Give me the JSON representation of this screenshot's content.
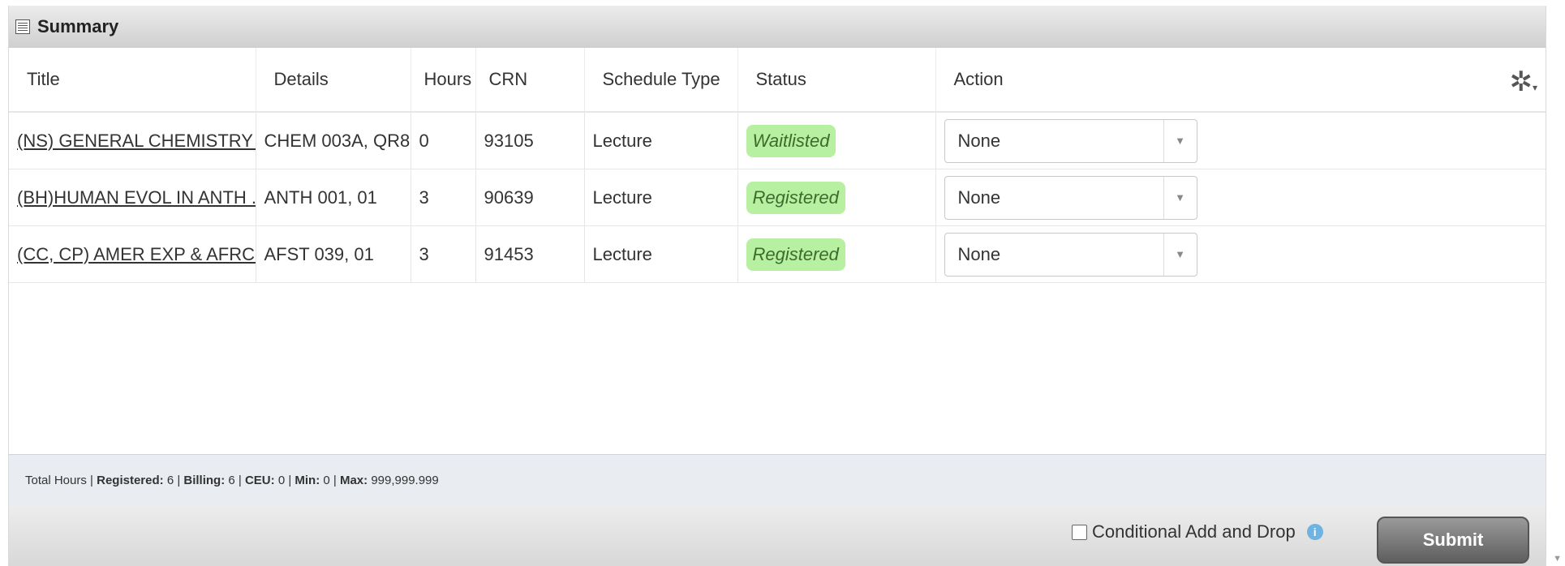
{
  "panel": {
    "title": "Summary"
  },
  "table": {
    "headers": [
      "Title",
      "Details",
      "Hours",
      "CRN",
      "Schedule Type",
      "Status",
      "Action"
    ],
    "rows": [
      {
        "title": "(NS) GENERAL CHEMISTRY I",
        "details": "CHEM 003A, QR8",
        "hours": "0",
        "crn": "93105",
        "schedule_type": "Lecture",
        "status": "Waitlisted",
        "action": "None"
      },
      {
        "title": "(BH)HUMAN EVOL IN ANTH ...",
        "details": "ANTH 001, 01",
        "hours": "3",
        "crn": "90639",
        "schedule_type": "Lecture",
        "status": "Registered",
        "action": "None"
      },
      {
        "title": "(CC, CP) AMER EXP & AFRC...",
        "details": "AFST 039, 01",
        "hours": "3",
        "crn": "91453",
        "schedule_type": "Lecture",
        "status": "Registered",
        "action": "None"
      }
    ]
  },
  "totals": {
    "prefix": "Total Hours |",
    "registered_label": "Registered:",
    "registered": "6",
    "billing_label": "Billing:",
    "billing": "6",
    "ceu_label": "CEU:",
    "ceu": "0",
    "min_label": "Min:",
    "min": "0",
    "max_label": "Max:",
    "max": "999,999.999"
  },
  "footer": {
    "conditional_label": "Conditional Add and Drop",
    "conditional_checked": false,
    "submit_label": "Submit"
  },
  "colors": {
    "status_badge": "#b6f0a0",
    "header_bg": "#d8d8d8",
    "totals_bg": "#e9edf1",
    "submit_bg": "#7a7a7a"
  },
  "icons": [
    "summary-table-icon",
    "gear-icon",
    "chevron-down-icon",
    "info-icon",
    "checkbox"
  ]
}
